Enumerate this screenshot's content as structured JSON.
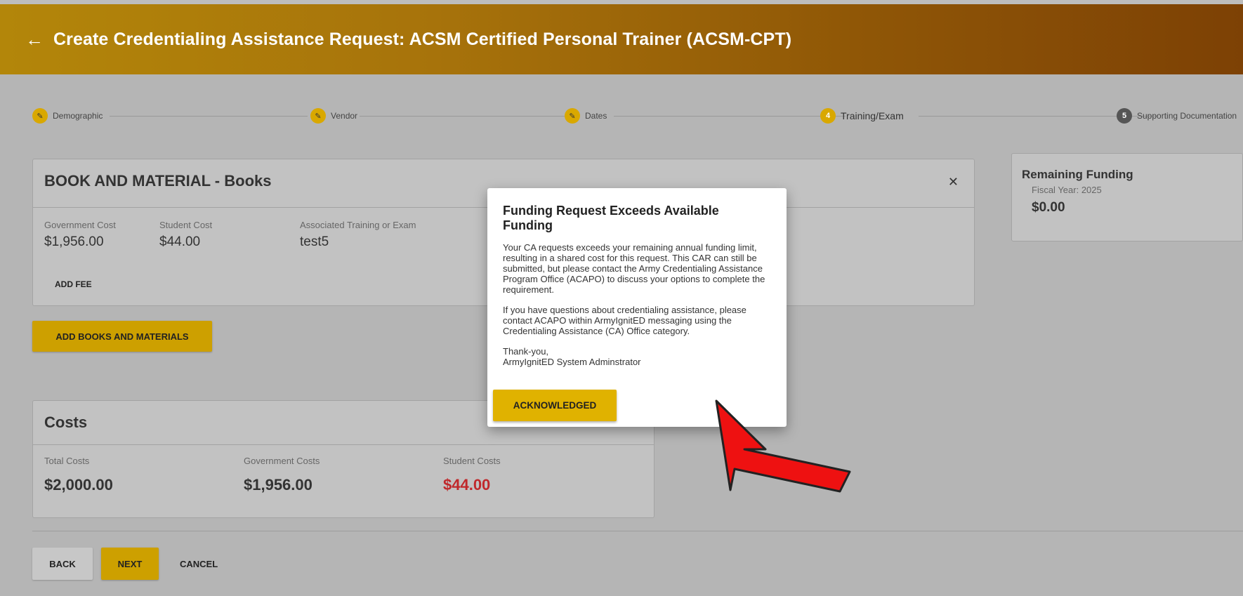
{
  "header": {
    "back_icon": "arrow-left-icon",
    "title": "Create Credentialing Assistance Request: ACSM Certified Personal Trainer (ACSM-CPT)"
  },
  "stepper": {
    "steps": [
      {
        "label": "Demographic",
        "marker": "✎",
        "state": "complete"
      },
      {
        "label": "Vendor",
        "marker": "✎",
        "state": "complete"
      },
      {
        "label": "Dates",
        "marker": "✎",
        "state": "complete"
      },
      {
        "label": "Training/Exam",
        "marker": "4",
        "state": "active"
      },
      {
        "label": "Supporting Documentation",
        "marker": "5",
        "state": "upcoming"
      }
    ]
  },
  "book_card": {
    "title": "BOOK AND MATERIAL - Books",
    "close_icon": "close-icon",
    "government_cost_label": "Government Cost",
    "government_cost_value": "$1,956.00",
    "student_cost_label": "Student Cost",
    "student_cost_value": "$44.00",
    "associated_label": "Associated Training or Exam",
    "associated_value": "test5",
    "add_fee_label": "ADD FEE"
  },
  "add_books_label": "ADD BOOKS AND MATERIALS",
  "costs_card": {
    "title": "Costs",
    "total_label": "Total Costs",
    "total_value": "$2,000.00",
    "government_label": "Government Costs",
    "government_value": "$1,956.00",
    "student_label": "Student Costs",
    "student_value": "$44.00"
  },
  "remaining_funding": {
    "title": "Remaining Funding",
    "fiscal_year": "Fiscal Year: 2025",
    "amount": "$0.00"
  },
  "footer_buttons": {
    "back": "BACK",
    "next": "NEXT",
    "cancel": "CANCEL"
  },
  "modal": {
    "title": "Funding Request Exceeds Available Funding",
    "paragraph1": "Your CA requests exceeds your remaining annual funding limit, resulting in a shared cost for this request. This CAR can still be submitted, but please contact the Army Credentialing Assistance Program Office (ACAPO) to discuss your options to complete the requirement.",
    "paragraph2": "If you have questions about credentialing assistance, please contact ACAPO within ArmyIgnitED messaging using the Credentialing Assistance (CA) Office category.",
    "signoff_line1": "Thank-you,",
    "signoff_line2": "ArmyIgnitED System Adminstrator",
    "button_label": "ACKNOWLEDGED"
  },
  "colors": {
    "header_start": "#b3860a",
    "header_end": "#7d4105",
    "accent_gold": "#e0b200",
    "student_cost_red": "#c0282b",
    "annotation_arrow": "#ee1111"
  }
}
